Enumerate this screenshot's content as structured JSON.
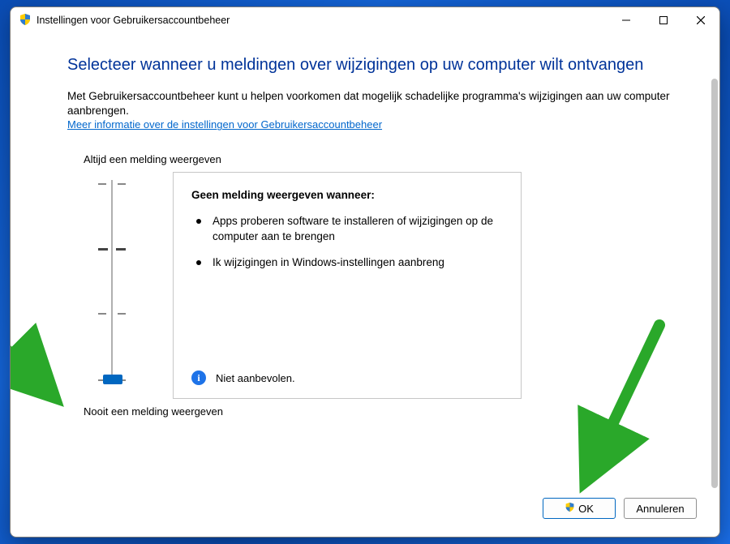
{
  "window": {
    "title": "Instellingen voor Gebruikersaccountbeheer"
  },
  "heading": "Selecteer wanneer u meldingen over wijzigingen op uw computer wilt ontvangen",
  "intro1": "Met Gebruikersaccountbeheer kunt u helpen voorkomen dat mogelijk schadelijke programma's wijzigingen aan uw computer aanbrengen.",
  "link": "Meer informatie over de instellingen voor Gebruikersaccountbeheer",
  "slider": {
    "top_label": "Altijd een melding weergeven",
    "bottom_label": "Nooit een melding weergeven",
    "level": 0,
    "levels": 4
  },
  "info": {
    "title": "Geen melding weergeven wanneer:",
    "bullets": [
      "Apps proberen software te installeren of wijzigingen op de computer aan te brengen",
      "Ik wijzigingen in Windows-instellingen aanbreng"
    ],
    "recommendation": "Niet aanbevolen."
  },
  "buttons": {
    "ok": "OK",
    "cancel": "Annuleren"
  }
}
